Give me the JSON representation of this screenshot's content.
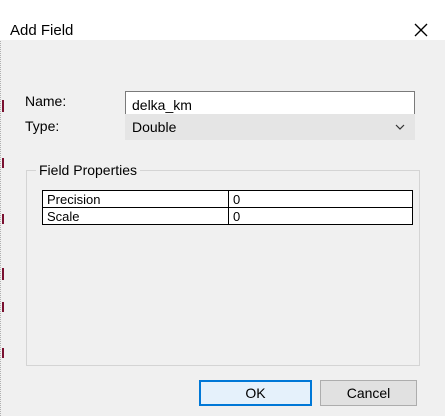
{
  "window": {
    "title": "Add Field"
  },
  "form": {
    "name_label": "Name:",
    "name_value": "delka_km",
    "type_label": "Type:",
    "type_value": "Double"
  },
  "field_properties": {
    "title": "Field Properties",
    "rows": [
      {
        "key": "Precision",
        "value": "0"
      },
      {
        "key": "Scale",
        "value": "0"
      }
    ]
  },
  "buttons": {
    "ok": "OK",
    "cancel": "Cancel"
  },
  "icons": {
    "close": "close-icon",
    "dropdown": "chevron-down-icon"
  },
  "colors": {
    "accent": "#0078d7",
    "mark": "#7a1030"
  }
}
